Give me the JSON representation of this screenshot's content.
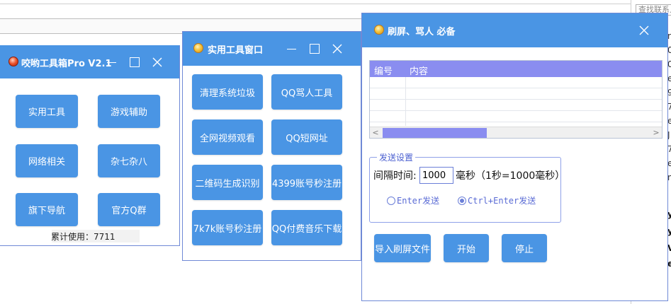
{
  "background": {
    "search_placeholder": "查找联系人",
    "right_fragments": [
      "r",
      "0",
      "0",
      "e",
      "9",
      "7",
      "e",
      "J",
      "7",
      "e",
      "n",
      "y",
      "y",
      "V",
      "e"
    ]
  },
  "main_window": {
    "title": "咬哟工具箱Pro V2.1",
    "buttons": [
      "实用工具",
      "游戏辅助",
      "网络相关",
      "杂七杂八",
      "旗下导航",
      "官方Q群"
    ],
    "usage_label": "累计使用：",
    "usage_count": "7711"
  },
  "tools_window": {
    "title": "实用工具窗口",
    "buttons": [
      "清理系统垃圾",
      "QQ骂人工具",
      "全网视频观看",
      "QQ短网址",
      "二维码生成识别",
      "4399账号秒注册",
      "7k7k账号秒注册",
      "QQ付费音乐下载"
    ]
  },
  "spam_window": {
    "title": "刷屏、骂人 必备",
    "table": {
      "columns": [
        "编号",
        "内容"
      ],
      "rows": []
    },
    "send_settings": {
      "legend": "发送设置",
      "interval_label": "间隔时间:",
      "interval_value": "1000",
      "interval_unit": "毫秒（1秒=1000毫秒）",
      "options": [
        {
          "label": "Enter发送",
          "selected": false
        },
        {
          "label": "Ctrl+Enter发送",
          "selected": true
        }
      ]
    },
    "buttons": {
      "import": "导入刷屏文件",
      "start": "开始",
      "stop": "停止"
    }
  },
  "colors": {
    "titlebar": "#4a95e4",
    "button": "#4a95e4",
    "table_header": "#8a8df0",
    "border": "#6f89d6"
  }
}
